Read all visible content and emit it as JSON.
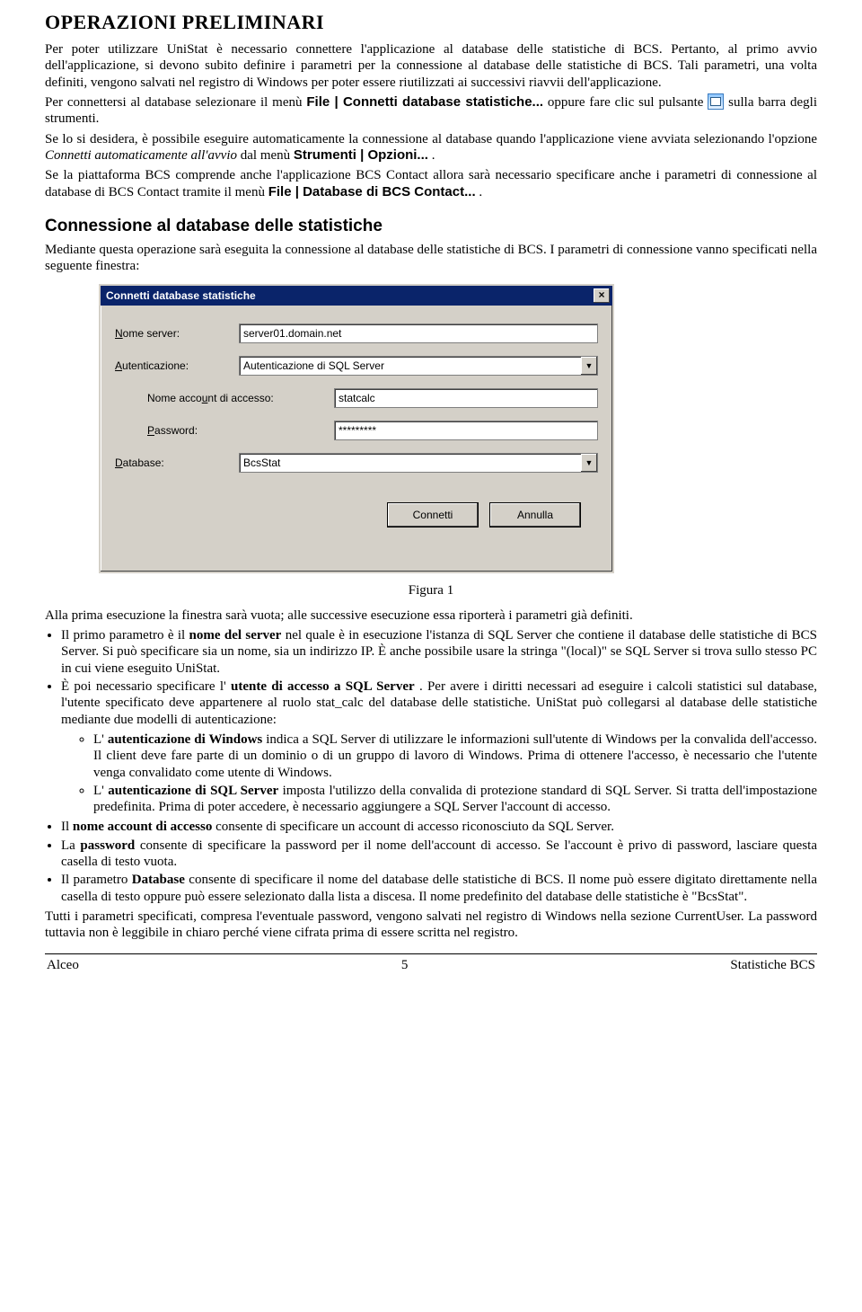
{
  "heading": "OPERAZIONI PRELIMINARI",
  "para1_a": "Per poter utilizzare UniStat è necessario connettere l'applicazione al database delle statistiche di BCS. Pertanto, al primo avvio dell'applicazione, si devono subito definire i parametri per la connessione al database delle statistiche di BCS. Tali parametri, una volta definiti, vengono salvati nel registro di Windows per poter essere riutilizzati ai successivi riavvii dell'applicazione.",
  "para2_a": "Per connettersi al database selezionare il menù ",
  "para2_bold1": "File | Connetti database statistiche...",
  "para2_b": " oppure fare clic sul pulsante ",
  "para2_c": " sulla barra degli strumenti.",
  "para3_a": "Se lo si desidera, è possibile eseguire automaticamente la connessione al database quando l'applicazione viene avviata selezionando l'opzione ",
  "para3_ital": "Connetti automaticamente all'avvio",
  "para3_b": " dal menù ",
  "para3_bold": "Strumenti | Opzioni...",
  "para3_c": ".",
  "para4_a": "Se la piattaforma BCS comprende anche l'applicazione BCS Contact allora sarà necessario specificare anche i parametri di connessione al database di BCS Contact tramite il menù ",
  "para4_bold": "File | Database di BCS Contact...",
  "para4_b": ".",
  "section": "Connessione al database delle statistiche",
  "sec_para": "Mediante questa operazione sarà eseguita la connessione al database delle statistiche di BCS. I parametri di connessione vanno specificati nella seguente finestra:",
  "dialog": {
    "title": "Connetti database statistiche",
    "lbl_server": "Nome server:",
    "val_server": "server01.domain.net",
    "lbl_auth": "Autenticazione:",
    "val_auth": "Autenticazione di SQL Server",
    "lbl_account": "Nome account di accesso:",
    "val_account": "statcalc",
    "lbl_pwd": "Password:",
    "val_pwd": "*********",
    "lbl_db": "Database:",
    "val_db": "BcsStat",
    "btn_connect": "Connetti",
    "btn_cancel": "Annulla"
  },
  "figcaption": "Figura 1",
  "post1": "Alla prima esecuzione la finestra sarà vuota; alle successive esecuzione essa riporterà i parametri già definiti.",
  "b1_a": "Il primo parametro è il ",
  "b1_bold": "nome del server",
  "b1_b": " nel quale è in esecuzione l'istanza di SQL Server che contiene il database delle statistiche di BCS Server. Si può specificare sia un nome, sia un indirizzo IP. È anche possibile usare la stringa \"(local)\" se SQL Server si trova sullo stesso PC in cui viene eseguito UniStat.",
  "b2_a": "È poi necessario specificare l'",
  "b2_bold": "utente di accesso a SQL Server",
  "b2_b": ". Per avere i diritti necessari ad eseguire i calcoli statistici sul database, l'utente specificato deve appartenere al ruolo stat_calc del database delle statistiche. UniStat può collegarsi al database delle statistiche mediante due modelli di autenticazione:",
  "b2n1_a": "L'",
  "b2n1_bold": "autenticazione di Windows",
  "b2n1_b": " indica a SQL Server di utilizzare le informazioni sull'utente di Windows per la convalida dell'accesso. Il client deve fare parte di un dominio o di un gruppo di lavoro di Windows. Prima di ottenere l'accesso, è necessario che l'utente venga convalidato come utente di Windows.",
  "b2n2_a": "L'",
  "b2n2_bold": "autenticazione di SQL Server",
  "b2n2_b": " imposta l'utilizzo della convalida di protezione standard di SQL Server. Si tratta dell'impostazione predefinita. Prima di poter accedere, è necessario aggiungere a SQL Server l'account di accesso.",
  "b3_a": "Il ",
  "b3_bold": "nome account di accesso",
  "b3_b": " consente di specificare un account di accesso riconosciuto da SQL Server.",
  "b4_a": "La ",
  "b4_bold": "password",
  "b4_b": " consente di specificare la password per il nome dell'account di accesso. Se l'account è privo di password, lasciare questa casella di testo vuota.",
  "b5_a": "Il parametro ",
  "b5_bold": "Database",
  "b5_b": " consente di specificare il nome del database delle statistiche di BCS. Il nome può essere digitato direttamente nella casella di testo oppure può essere selezionato dalla lista a discesa. Il nome predefinito del database delle statistiche è \"BcsStat\".",
  "post2": "Tutti i parametri specificati, compresa l'eventuale password, vengono salvati nel registro di Windows nella sezione CurrentUser. La password tuttavia non è leggibile in chiaro perché viene cifrata prima di essere scritta nel registro.",
  "footer_left": "Alceo",
  "footer_center": "5",
  "footer_right": "Statistiche BCS"
}
